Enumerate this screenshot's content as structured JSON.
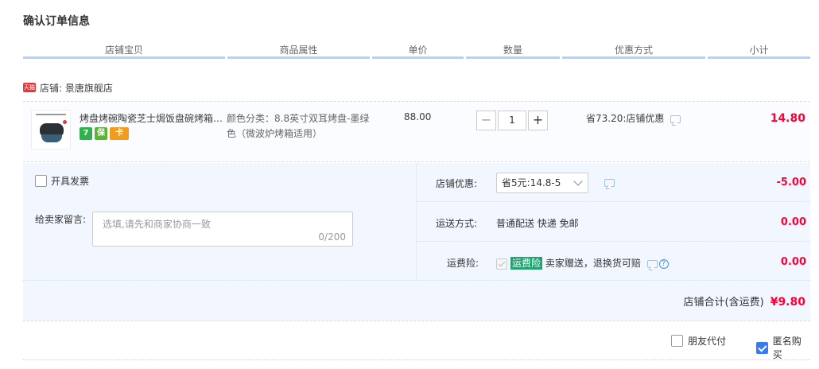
{
  "title": "确认订单信息",
  "columns": [
    "店铺宝贝",
    "商品属性",
    "单价",
    "数量",
    "优惠方式",
    "小计"
  ],
  "shop": {
    "badge": "天猫",
    "label": "店铺: 景唐旗舰店"
  },
  "item": {
    "name": "烤盘烤碗陶瓷芝士焗饭盘碗烤箱专用",
    "badges": [
      "7",
      "保",
      "卡"
    ],
    "attribute": "颜色分类：8.8英寸双耳烤盘-墨绿色（微波炉烤箱适用）",
    "price": "88.00",
    "quantity": "1",
    "minus": "−",
    "plus": "+",
    "discount": "省73.20:店铺优惠",
    "subtotal": "14.80"
  },
  "invoice": {
    "label": "开具发票"
  },
  "message": {
    "label": "给卖家留言:",
    "placeholder": "选填,请先和商家协商一致",
    "counter": "0/200"
  },
  "shop_discount": {
    "label": "店铺优惠:",
    "selected": "省5元:14.8-5",
    "amount": "-5.00"
  },
  "shipping": {
    "label": "运送方式:",
    "value": "普通配送 快递 免邮",
    "amount": "0.00"
  },
  "insurance": {
    "label": "运费险:",
    "tag": "运费险",
    "text": "卖家赠送，退换货可赔",
    "amount": "0.00",
    "help": "?"
  },
  "total": {
    "label": "店铺合计(含运费)",
    "amount": "¥9.80"
  },
  "options": {
    "friend_pay": "朋友代付",
    "anonymous": "匿名购买"
  },
  "colors": {
    "accent": "#ff0036",
    "header_line": "#b2d1ff",
    "panel_bg": "#f2f7ff",
    "checkbox_checked": "#3a7af0"
  }
}
